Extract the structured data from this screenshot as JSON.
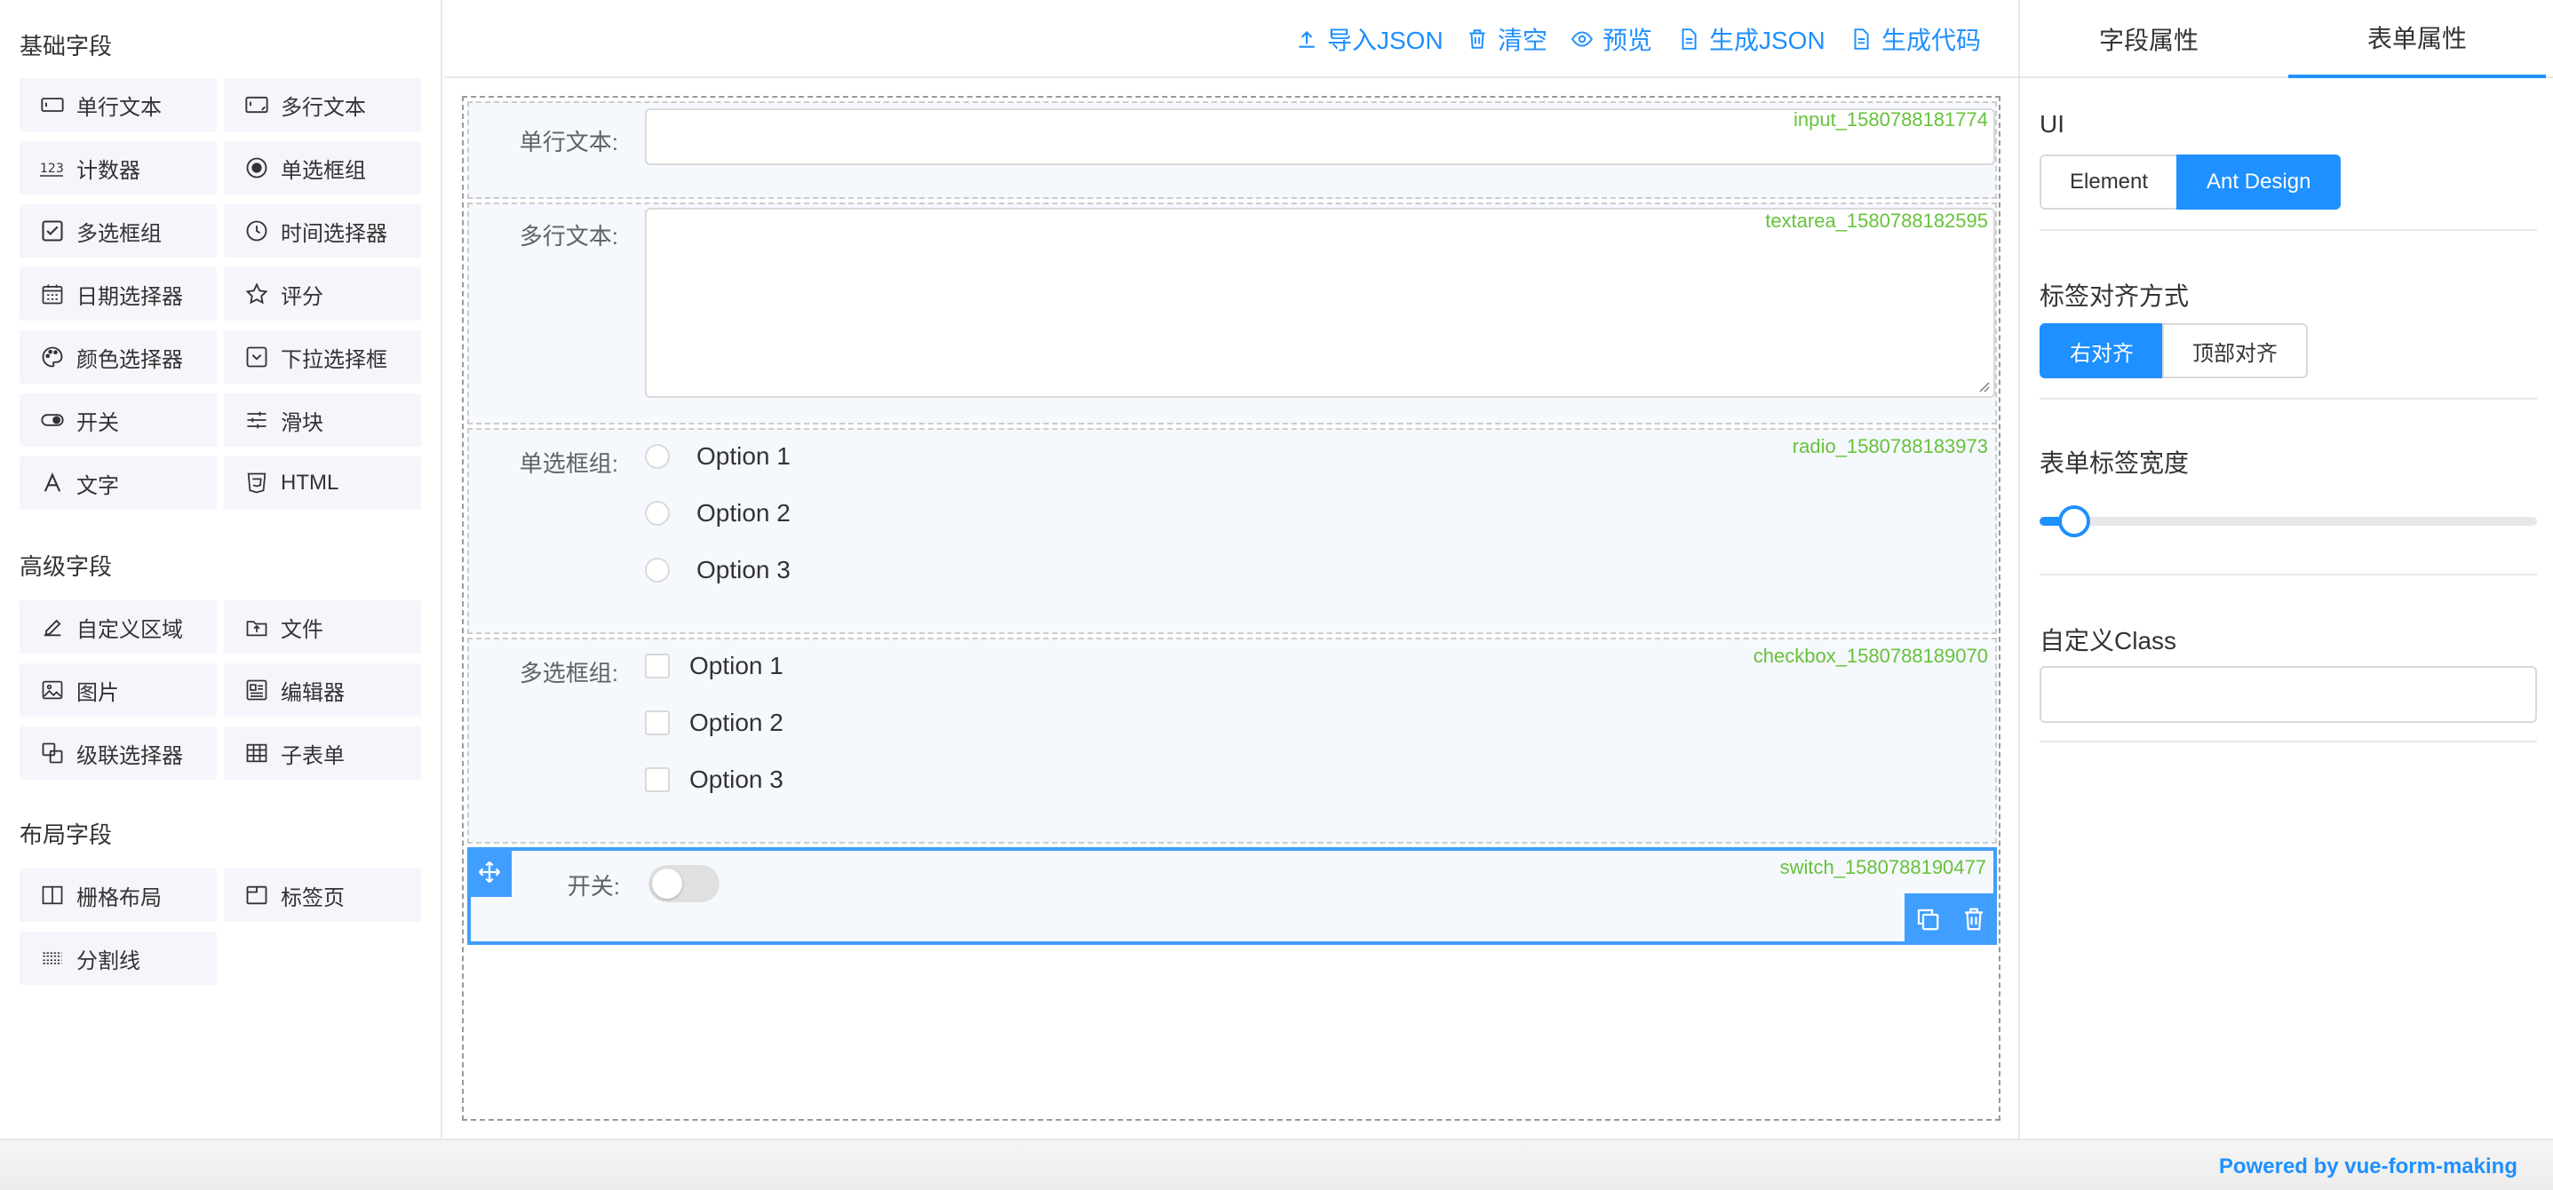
{
  "left": {
    "basic_title": "基础字段",
    "advanced_title": "高级字段",
    "layout_title": "布局字段",
    "basic": [
      {
        "label": "单行文本",
        "icon": "input-icon"
      },
      {
        "label": "多行文本",
        "icon": "textarea-icon"
      },
      {
        "label": "计数器",
        "icon": "number-icon"
      },
      {
        "label": "单选框组",
        "icon": "radio-icon"
      },
      {
        "label": "多选框组",
        "icon": "checkbox-icon"
      },
      {
        "label": "时间选择器",
        "icon": "clock-icon"
      },
      {
        "label": "日期选择器",
        "icon": "calendar-icon"
      },
      {
        "label": "评分",
        "icon": "star-icon"
      },
      {
        "label": "颜色选择器",
        "icon": "palette-icon"
      },
      {
        "label": "下拉选择框",
        "icon": "select-icon"
      },
      {
        "label": "开关",
        "icon": "switch-icon"
      },
      {
        "label": "滑块",
        "icon": "slider-icon"
      },
      {
        "label": "文字",
        "icon": "text-icon"
      },
      {
        "label": "HTML",
        "icon": "html-icon"
      }
    ],
    "advanced": [
      {
        "label": "自定义区域",
        "icon": "edit-icon"
      },
      {
        "label": "文件",
        "icon": "file-upload-icon"
      },
      {
        "label": "图片",
        "icon": "image-icon"
      },
      {
        "label": "编辑器",
        "icon": "editor-icon"
      },
      {
        "label": "级联选择器",
        "icon": "cascader-icon"
      },
      {
        "label": "子表单",
        "icon": "table-icon"
      }
    ],
    "layout": [
      {
        "label": "栅格布局",
        "icon": "grid-icon"
      },
      {
        "label": "标签页",
        "icon": "tabs-icon"
      },
      {
        "label": "分割线",
        "icon": "divider-icon"
      }
    ]
  },
  "toolbar": {
    "import": "导入JSON",
    "clear": "清空",
    "preview": "预览",
    "gen_json": "生成JSON",
    "gen_code": "生成代码"
  },
  "form": {
    "input": {
      "label": "单行文本:",
      "id": "input_1580788181774"
    },
    "textarea": {
      "label": "多行文本:",
      "id": "textarea_1580788182595"
    },
    "radio": {
      "label": "单选框组:",
      "id": "radio_1580788183973",
      "options": [
        "Option 1",
        "Option 2",
        "Option 3"
      ]
    },
    "checkbox": {
      "label": "多选框组:",
      "id": "checkbox_1580788189070",
      "options": [
        "Option 1",
        "Option 2",
        "Option 3"
      ]
    },
    "switch": {
      "label": "开关:",
      "id": "switch_1580788190477",
      "value": false
    }
  },
  "right": {
    "tab_field": "字段属性",
    "tab_form": "表单属性",
    "ui_title": "UI",
    "ui_options": [
      "Element",
      "Ant Design"
    ],
    "ui_selected": "Ant Design",
    "align_title": "标签对齐方式",
    "align_options": [
      "右对齐",
      "顶部对齐"
    ],
    "align_selected": "右对齐",
    "label_width_title": "表单标签宽度",
    "label_width_fraction": 0.07,
    "class_title": "自定义Class",
    "class_value": ""
  },
  "footer": {
    "powered": "Powered by vue-form-making"
  },
  "colors": {
    "accent": "#1e90ff",
    "id_green": "#67c23a",
    "panel_bg": "#f4f6fc"
  }
}
